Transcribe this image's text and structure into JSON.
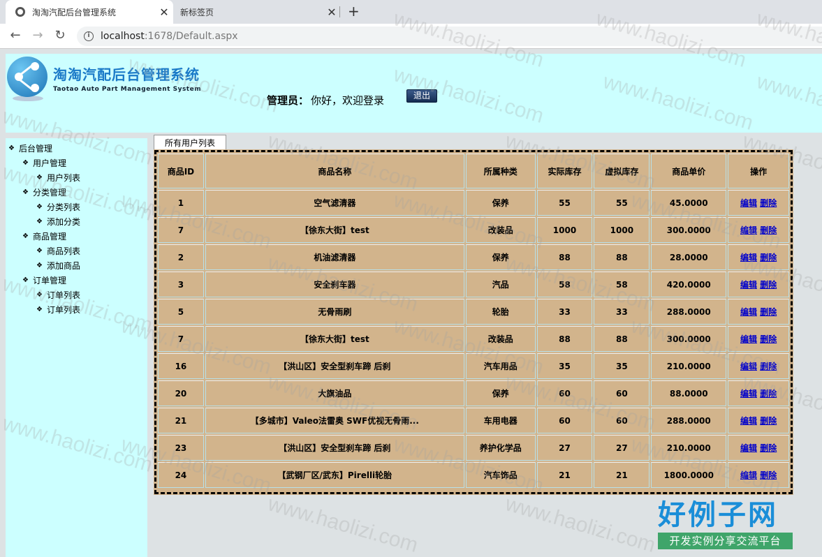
{
  "browser": {
    "tabs": [
      {
        "title": "淘淘汽配后台管理系统",
        "active": true
      },
      {
        "title": "新标签页",
        "active": false
      }
    ],
    "url_host": "localhost",
    "url_path": ":1678/Default.aspx"
  },
  "header": {
    "title": "淘淘汽配后台管理系统",
    "subtitle": "Taotao Auto Part Management System",
    "admin_label": "管理员：",
    "admin_msg": "你好，欢迎登录",
    "logout": "退出"
  },
  "sidebar": {
    "root": "后台管理",
    "groups": [
      {
        "label": "用户管理",
        "items": [
          "用户列表"
        ]
      },
      {
        "label": "分类管理",
        "items": [
          "分类列表",
          "添加分类"
        ]
      },
      {
        "label": "商品管理",
        "items": [
          "商品列表",
          "添加商品"
        ]
      },
      {
        "label": "订单管理",
        "items": [
          "订单列表",
          "订单列表"
        ]
      }
    ]
  },
  "main": {
    "tab_label": "所有用户列表",
    "columns": [
      "商品ID",
      "商品名称",
      "所属种类",
      "实际库存",
      "虚拟库存",
      "商品单价",
      "操作"
    ],
    "edit_label": "编辑",
    "delete_label": "删除",
    "rows": [
      [
        "1",
        "空气滤清器",
        "保养",
        "55",
        "55",
        "45.0000"
      ],
      [
        "7",
        "【徐东大街】test",
        "改装品",
        "1000",
        "1000",
        "300.0000"
      ],
      [
        "2",
        "机油滤清器",
        "保养",
        "88",
        "88",
        "28.0000"
      ],
      [
        "3",
        "安全刹车器",
        "汽品",
        "58",
        "58",
        "420.0000"
      ],
      [
        "5",
        "无骨雨刷",
        "轮胎",
        "33",
        "33",
        "288.0000"
      ],
      [
        "7",
        "【徐东大街】test",
        "改装品",
        "88",
        "88",
        "300.0000"
      ],
      [
        "16",
        "【洪山区】安全型刹车蹄 后刹",
        "汽车用品",
        "35",
        "35",
        "210.0000"
      ],
      [
        "20",
        "大旗油品",
        "保养",
        "60",
        "60",
        "88.0000"
      ],
      [
        "21",
        "【多城市】Valeo法雷奥 SWF优视无骨雨...",
        "车用电器",
        "60",
        "60",
        "288.0000"
      ],
      [
        "23",
        "【洪山区】安全型刹车蹄 后刹",
        "养护化学品",
        "27",
        "27",
        "210.0000"
      ],
      [
        "24",
        "【武钢厂区/武东】Pirelli轮胎",
        "汽车饰品",
        "21",
        "21",
        "1800.0000"
      ]
    ]
  },
  "watermark": "www.haolizi.com",
  "brand": {
    "big": "好例子网",
    "small": "开发实例分享交流平台"
  }
}
